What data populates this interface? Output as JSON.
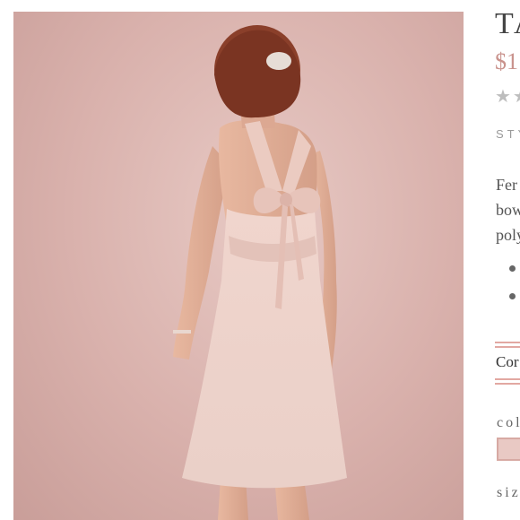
{
  "product": {
    "image_alt": "Back view of model in blush tulle halter dress with bow",
    "title": "TA",
    "price": "$1",
    "stars_display": "★★",
    "style_label": "STY",
    "description_lines": [
      "Fer",
      "bow",
      "poly"
    ],
    "bullets": [
      "",
      ""
    ],
    "accordion_label": "Cor",
    "color_label": "col",
    "size_label": "siz"
  },
  "colors": {
    "accent": "#d9a7a1",
    "swatch": "#e9c9c4",
    "background_photo": "#dcb5b0"
  }
}
